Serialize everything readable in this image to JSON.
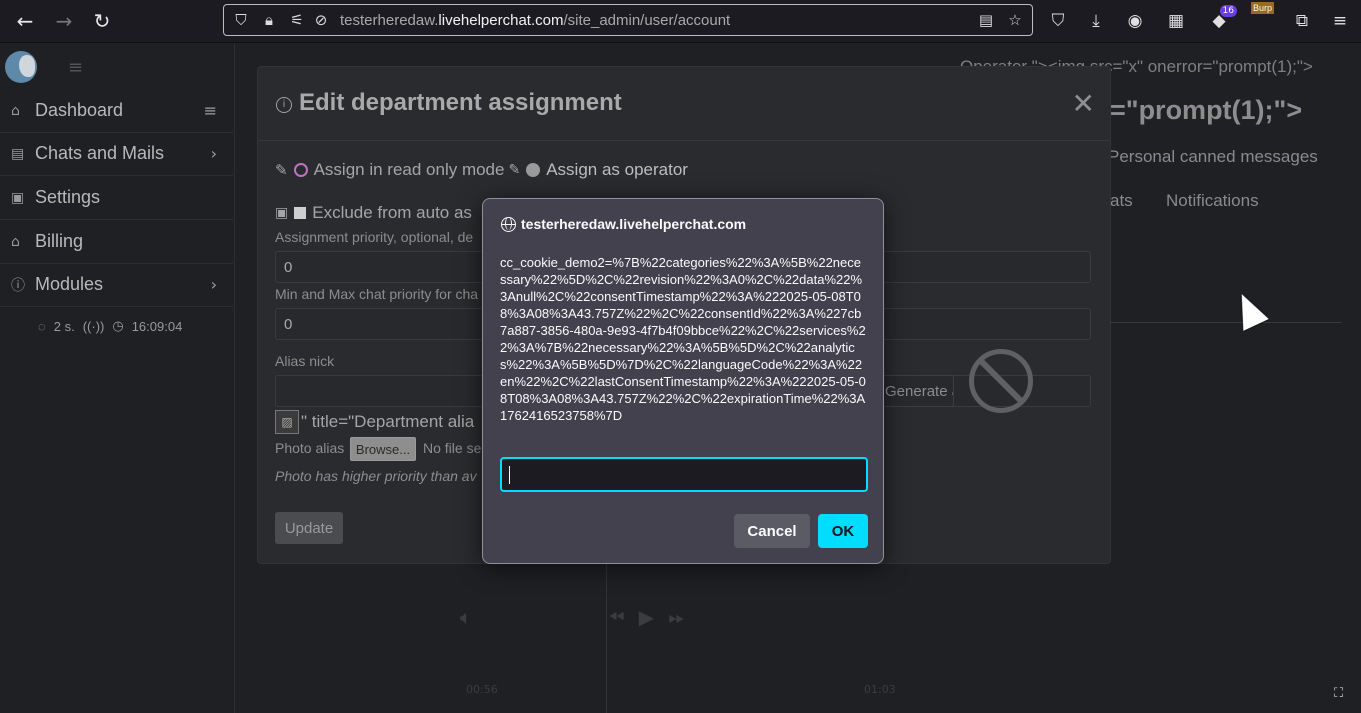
{
  "browser": {
    "url_prefix": "testerheredaw.",
    "url_domain": "livehelperchat.com",
    "url_path": "/site_admin/user/account",
    "extension_badge": "16",
    "burp_label": "Burp"
  },
  "sidebar": {
    "items": [
      {
        "label": "Dashboard",
        "icon": "home-icon"
      },
      {
        "label": "Chats and Mails",
        "icon": "chat-icon"
      },
      {
        "label": "Settings",
        "icon": "gear-icon"
      },
      {
        "label": "Billing",
        "icon": "bank-icon"
      },
      {
        "label": "Modules",
        "icon": "info-icon"
      }
    ],
    "status_interval": "2 s.",
    "status_time": "16:09:04"
  },
  "background": {
    "top_text": "Operator \"><img src=\"x\" onerror=\"prompt(1);\">",
    "heading": "=\"prompt(1);\">",
    "canned": "Personal canned messages",
    "tab_chats": "ats",
    "tab_notifications": "Notifications"
  },
  "modal": {
    "title": "Edit department assignment",
    "radio_readonly": "Assign in read only mode",
    "radio_operator": "Assign as operator",
    "exclude_label": "Exclude from auto as",
    "priority_label": "Assignment priority, optional, de",
    "priority_value": "0",
    "minmax_label": "Min and Max chat priority for cha",
    "minmax_value": "0",
    "alias_label": "Alias nick",
    "alias_title_text": "\" title=\"Department alia",
    "photo_alias_label": "Photo alias",
    "browse_label": "Browse...",
    "no_file_label": "No file sel",
    "photo_hint": "Photo has higher priority than av",
    "generate_label": "Generate a",
    "update_label": "Update"
  },
  "dialog": {
    "origin": "testerheredaw.livehelperchat.com",
    "message": "cc_cookie_demo2=%7B%22categories%22%3A%5B%22necessary%22%5D%2C%22revision%22%3A0%2C%22data%22%3Anull%2C%22consentTimestamp%22%3A%222025-05-08T08%3A08%3A43.757Z%22%2C%22consentId%22%3A%227cb7a887-3856-480a-9e93-4f7b4f09bbce%22%2C%22services%22%3A%7B%22necessary%22%3A%5B%5D%2C%22analytics%22%3A%5B%5D%7D%2C%22languageCode%22%3A%22en%22%2C%22lastConsentTimestamp%22%3A%222025-05-08T08%3A08%3A43.757Z%22%2C%22expirationTime%22%3A1762416523758%7D",
    "input_value": "",
    "cancel_label": "Cancel",
    "ok_label": "OK"
  },
  "player": {
    "time_start": "00:56",
    "time_end": "01:03"
  },
  "colors": {
    "accent": "#00ddff",
    "dialog_bg": "#42414d",
    "page_bg": "#232427"
  }
}
